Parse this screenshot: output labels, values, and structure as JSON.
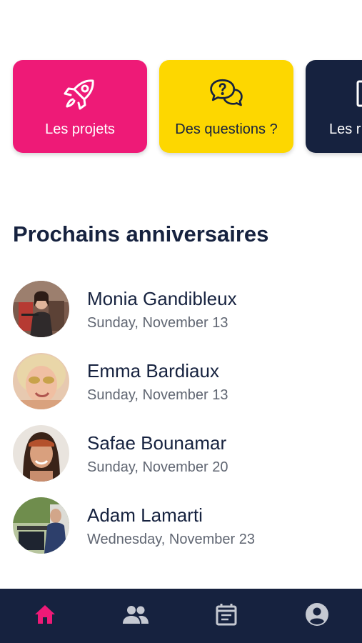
{
  "cards": [
    {
      "label": "Les projets",
      "icon": "rocket-icon",
      "color": "#ee1a77"
    },
    {
      "label": "Des questions ?",
      "icon": "question-chat-icon",
      "color": "#fdd700"
    },
    {
      "label": "Les r",
      "icon": "document-icon",
      "color": "#16223f"
    }
  ],
  "section": {
    "title": "Prochains anniversaires"
  },
  "birthdays": [
    {
      "name": "Monia Gandibleux",
      "date": "Sunday, November 13"
    },
    {
      "name": "Emma Bardiaux",
      "date": "Sunday, November 13"
    },
    {
      "name": "Safae Bounamar",
      "date": "Sunday, November 20"
    },
    {
      "name": "Adam Lamarti",
      "date": "Wednesday, November 23"
    }
  ],
  "nav": {
    "items": [
      "home-icon",
      "people-icon",
      "calendar-icon",
      "account-icon"
    ],
    "active": "home-icon",
    "active_color": "#ee1a77",
    "inactive_color": "#c5c9d2"
  },
  "colors": {
    "navy": "#16223f",
    "pink": "#ee1a77",
    "yellow": "#fdd700"
  }
}
